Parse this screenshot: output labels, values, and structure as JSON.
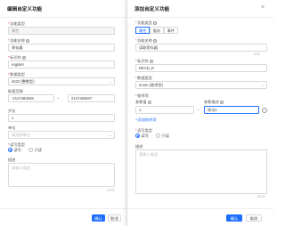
{
  "left_panel": {
    "title": "编辑自定义功能",
    "fields": {
      "func_type": {
        "label": "功能类型",
        "value": "属性"
      },
      "func_name": {
        "label": "功能名称",
        "value": "寄存器"
      },
      "identifier": {
        "label": "标识符",
        "value": "register"
      },
      "data_type": {
        "label": "数据类型",
        "value": "int32 (整数型)"
      },
      "range": {
        "label": "取值范围",
        "min": "-2147483648",
        "max": "2147483647",
        "sep": "~"
      },
      "step": {
        "label": "步长",
        "value": "1"
      },
      "unit": {
        "label": "单位",
        "placeholder": "请选择单位"
      },
      "rw_type": {
        "label": "读写类型",
        "options": [
          "读写",
          "只读"
        ],
        "selected": "读写"
      },
      "description": {
        "label": "描述",
        "placeholder": "请输入描述",
        "counter": "0/100"
      }
    },
    "footer": {
      "confirm": "确认",
      "cancel": "取消"
    }
  },
  "right_panel": {
    "title": "添加自定义功能",
    "fields": {
      "func_type": {
        "label": "功能类型",
        "tabs": [
          "属性",
          "服务",
          "事件"
        ],
        "active": "属性"
      },
      "func_name": {
        "label": "功能名称",
        "value": "读取寄存器",
        "counter": "5/30"
      },
      "identifier": {
        "label": "标识符",
        "value": "READ_R"
      },
      "data_type": {
        "label": "数据类型",
        "value": "enum (枚举型)"
      },
      "enum_items": {
        "label": "枚举项",
        "param_value_label": "参数值",
        "param_desc_label": "参数描述",
        "row_value": "1",
        "row_desc": "地址1",
        "sep": "~",
        "add_link": "+添加枚举项"
      },
      "rw_type": {
        "label": "读写类型",
        "options": [
          "读写",
          "只读"
        ],
        "selected": "读写"
      },
      "description": {
        "label": "描述",
        "placeholder": "请输入描述",
        "counter": "0/100"
      }
    },
    "footer": {
      "confirm": "确认",
      "cancel": "取消"
    }
  }
}
